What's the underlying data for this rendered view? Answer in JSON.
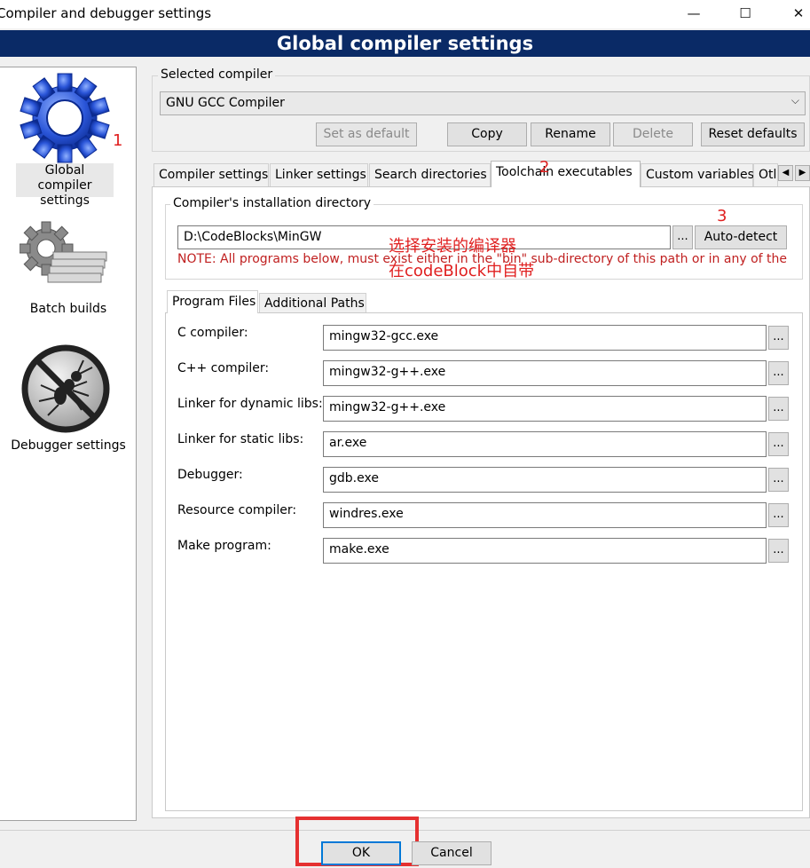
{
  "window": {
    "title": "Compiler and debugger settings",
    "minimize": "—",
    "maximize": "☐",
    "close": "✕"
  },
  "header": {
    "title": "Global compiler settings"
  },
  "sidebar": {
    "items": [
      {
        "label": "Global compiler settings",
        "selected": true
      },
      {
        "label": "Batch builds"
      },
      {
        "label": "Debugger settings"
      }
    ]
  },
  "selected_compiler": {
    "legend": "Selected compiler",
    "value": "GNU GCC Compiler",
    "buttons": {
      "set_default": "Set as default",
      "copy": "Copy",
      "rename": "Rename",
      "delete": "Delete",
      "reset": "Reset defaults"
    }
  },
  "tabs": [
    {
      "label": "Compiler settings"
    },
    {
      "label": "Linker settings"
    },
    {
      "label": "Search directories"
    },
    {
      "label": "Toolchain executables",
      "active": true
    },
    {
      "label": "Custom variables"
    },
    {
      "label": "Otl"
    }
  ],
  "install_dir": {
    "legend": "Compiler's installation directory",
    "value": "D:\\CodeBlocks\\MinGW",
    "browse": "...",
    "auto_detect": "Auto-detect",
    "note": "NOTE: All programs below, must exist either in the \"bin\" sub-directory of this path or in any of the"
  },
  "subtabs": [
    {
      "label": "Program Files",
      "active": true
    },
    {
      "label": "Additional Paths"
    }
  ],
  "programs": [
    {
      "label": "C compiler:",
      "value": "mingw32-gcc.exe"
    },
    {
      "label": "C++ compiler:",
      "value": "mingw32-g++.exe"
    },
    {
      "label": "Linker for dynamic libs:",
      "value": "mingw32-g++.exe"
    },
    {
      "label": "Linker for static libs:",
      "value": "ar.exe"
    },
    {
      "label": "Debugger:",
      "value": "gdb.exe"
    },
    {
      "label": "Resource compiler:",
      "value": "windres.exe"
    },
    {
      "label": "Make program:",
      "value": "make.exe"
    }
  ],
  "annotations": {
    "n1": "1",
    "n2": "2",
    "n3": "3",
    "zh1": "选择安装的编译器",
    "zh2": "在codeBlock中自带"
  },
  "footer": {
    "ok": "OK",
    "cancel": "Cancel"
  },
  "colors": {
    "header_bg": "#0a2a66",
    "annotation_red": "#e02020",
    "highlight_box": "#e53030"
  }
}
